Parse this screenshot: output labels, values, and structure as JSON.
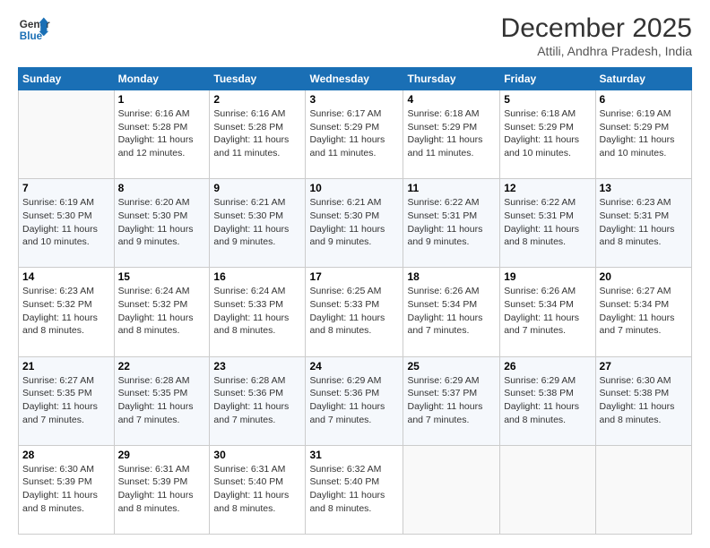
{
  "header": {
    "logo_line1": "General",
    "logo_line2": "Blue",
    "month": "December 2025",
    "location": "Attili, Andhra Pradesh, India"
  },
  "calendar": {
    "days_of_week": [
      "Sunday",
      "Monday",
      "Tuesday",
      "Wednesday",
      "Thursday",
      "Friday",
      "Saturday"
    ],
    "weeks": [
      [
        {
          "day": "",
          "info": ""
        },
        {
          "day": "1",
          "info": "Sunrise: 6:16 AM\nSunset: 5:28 PM\nDaylight: 11 hours and 12 minutes."
        },
        {
          "day": "2",
          "info": "Sunrise: 6:16 AM\nSunset: 5:28 PM\nDaylight: 11 hours and 11 minutes."
        },
        {
          "day": "3",
          "info": "Sunrise: 6:17 AM\nSunset: 5:29 PM\nDaylight: 11 hours and 11 minutes."
        },
        {
          "day": "4",
          "info": "Sunrise: 6:18 AM\nSunset: 5:29 PM\nDaylight: 11 hours and 11 minutes."
        },
        {
          "day": "5",
          "info": "Sunrise: 6:18 AM\nSunset: 5:29 PM\nDaylight: 11 hours and 10 minutes."
        },
        {
          "day": "6",
          "info": "Sunrise: 6:19 AM\nSunset: 5:29 PM\nDaylight: 11 hours and 10 minutes."
        }
      ],
      [
        {
          "day": "7",
          "info": "Sunrise: 6:19 AM\nSunset: 5:30 PM\nDaylight: 11 hours and 10 minutes."
        },
        {
          "day": "8",
          "info": "Sunrise: 6:20 AM\nSunset: 5:30 PM\nDaylight: 11 hours and 9 minutes."
        },
        {
          "day": "9",
          "info": "Sunrise: 6:21 AM\nSunset: 5:30 PM\nDaylight: 11 hours and 9 minutes."
        },
        {
          "day": "10",
          "info": "Sunrise: 6:21 AM\nSunset: 5:30 PM\nDaylight: 11 hours and 9 minutes."
        },
        {
          "day": "11",
          "info": "Sunrise: 6:22 AM\nSunset: 5:31 PM\nDaylight: 11 hours and 9 minutes."
        },
        {
          "day": "12",
          "info": "Sunrise: 6:22 AM\nSunset: 5:31 PM\nDaylight: 11 hours and 8 minutes."
        },
        {
          "day": "13",
          "info": "Sunrise: 6:23 AM\nSunset: 5:31 PM\nDaylight: 11 hours and 8 minutes."
        }
      ],
      [
        {
          "day": "14",
          "info": "Sunrise: 6:23 AM\nSunset: 5:32 PM\nDaylight: 11 hours and 8 minutes."
        },
        {
          "day": "15",
          "info": "Sunrise: 6:24 AM\nSunset: 5:32 PM\nDaylight: 11 hours and 8 minutes."
        },
        {
          "day": "16",
          "info": "Sunrise: 6:24 AM\nSunset: 5:33 PM\nDaylight: 11 hours and 8 minutes."
        },
        {
          "day": "17",
          "info": "Sunrise: 6:25 AM\nSunset: 5:33 PM\nDaylight: 11 hours and 8 minutes."
        },
        {
          "day": "18",
          "info": "Sunrise: 6:26 AM\nSunset: 5:34 PM\nDaylight: 11 hours and 7 minutes."
        },
        {
          "day": "19",
          "info": "Sunrise: 6:26 AM\nSunset: 5:34 PM\nDaylight: 11 hours and 7 minutes."
        },
        {
          "day": "20",
          "info": "Sunrise: 6:27 AM\nSunset: 5:34 PM\nDaylight: 11 hours and 7 minutes."
        }
      ],
      [
        {
          "day": "21",
          "info": "Sunrise: 6:27 AM\nSunset: 5:35 PM\nDaylight: 11 hours and 7 minutes."
        },
        {
          "day": "22",
          "info": "Sunrise: 6:28 AM\nSunset: 5:35 PM\nDaylight: 11 hours and 7 minutes."
        },
        {
          "day": "23",
          "info": "Sunrise: 6:28 AM\nSunset: 5:36 PM\nDaylight: 11 hours and 7 minutes."
        },
        {
          "day": "24",
          "info": "Sunrise: 6:29 AM\nSunset: 5:36 PM\nDaylight: 11 hours and 7 minutes."
        },
        {
          "day": "25",
          "info": "Sunrise: 6:29 AM\nSunset: 5:37 PM\nDaylight: 11 hours and 7 minutes."
        },
        {
          "day": "26",
          "info": "Sunrise: 6:29 AM\nSunset: 5:38 PM\nDaylight: 11 hours and 8 minutes."
        },
        {
          "day": "27",
          "info": "Sunrise: 6:30 AM\nSunset: 5:38 PM\nDaylight: 11 hours and 8 minutes."
        }
      ],
      [
        {
          "day": "28",
          "info": "Sunrise: 6:30 AM\nSunset: 5:39 PM\nDaylight: 11 hours and 8 minutes."
        },
        {
          "day": "29",
          "info": "Sunrise: 6:31 AM\nSunset: 5:39 PM\nDaylight: 11 hours and 8 minutes."
        },
        {
          "day": "30",
          "info": "Sunrise: 6:31 AM\nSunset: 5:40 PM\nDaylight: 11 hours and 8 minutes."
        },
        {
          "day": "31",
          "info": "Sunrise: 6:32 AM\nSunset: 5:40 PM\nDaylight: 11 hours and 8 minutes."
        },
        {
          "day": "",
          "info": ""
        },
        {
          "day": "",
          "info": ""
        },
        {
          "day": "",
          "info": ""
        }
      ]
    ]
  }
}
